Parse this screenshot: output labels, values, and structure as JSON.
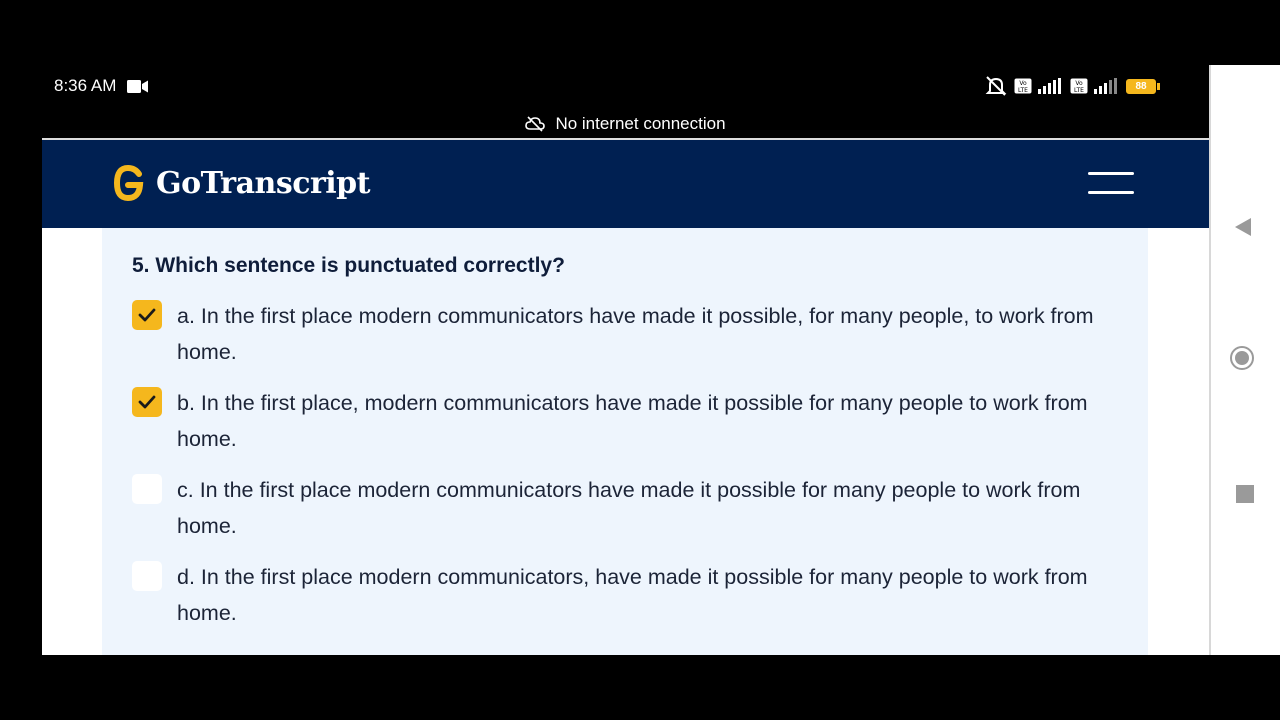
{
  "status_bar": {
    "time": "8:36 AM",
    "battery": "88"
  },
  "offline_notice": "No internet connection",
  "site": {
    "name": "GoTranscript"
  },
  "quiz": {
    "question": "5. Which sentence is punctuated correctly?",
    "options": [
      {
        "text": "a. In the first place modern communicators have made it possible, for many people, to work from home.",
        "checked": true
      },
      {
        "text": "b. In the first place, modern communicators have made it possible for many people to work from home.",
        "checked": true
      },
      {
        "text": "c. In the first place modern communicators have made it possible for many people to work from home.",
        "checked": false
      },
      {
        "text": "d. In the first place modern communicators, have made it possible for many people to work from home.",
        "checked": false
      }
    ]
  },
  "colors": {
    "header_bg": "#002052",
    "checkbox_checked": "#f5b71d",
    "card_bg": "#eef5fd"
  }
}
